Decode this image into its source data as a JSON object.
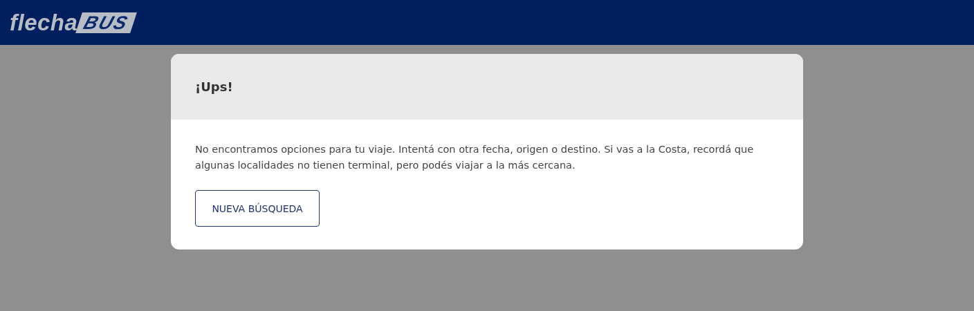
{
  "header": {
    "logo": {
      "word": "flecha",
      "badge": "BUS"
    }
  },
  "dialog": {
    "title": "¡Ups!",
    "message": "No encontramos opciones para tu viaje. Intentá con otra fecha, origen o destino. Si vas a la Costa, recordá que algunas localidades no tienen terminal, pero podés viajar a la más cercana.",
    "button": "NUEVA BÚSQUEDA"
  }
}
